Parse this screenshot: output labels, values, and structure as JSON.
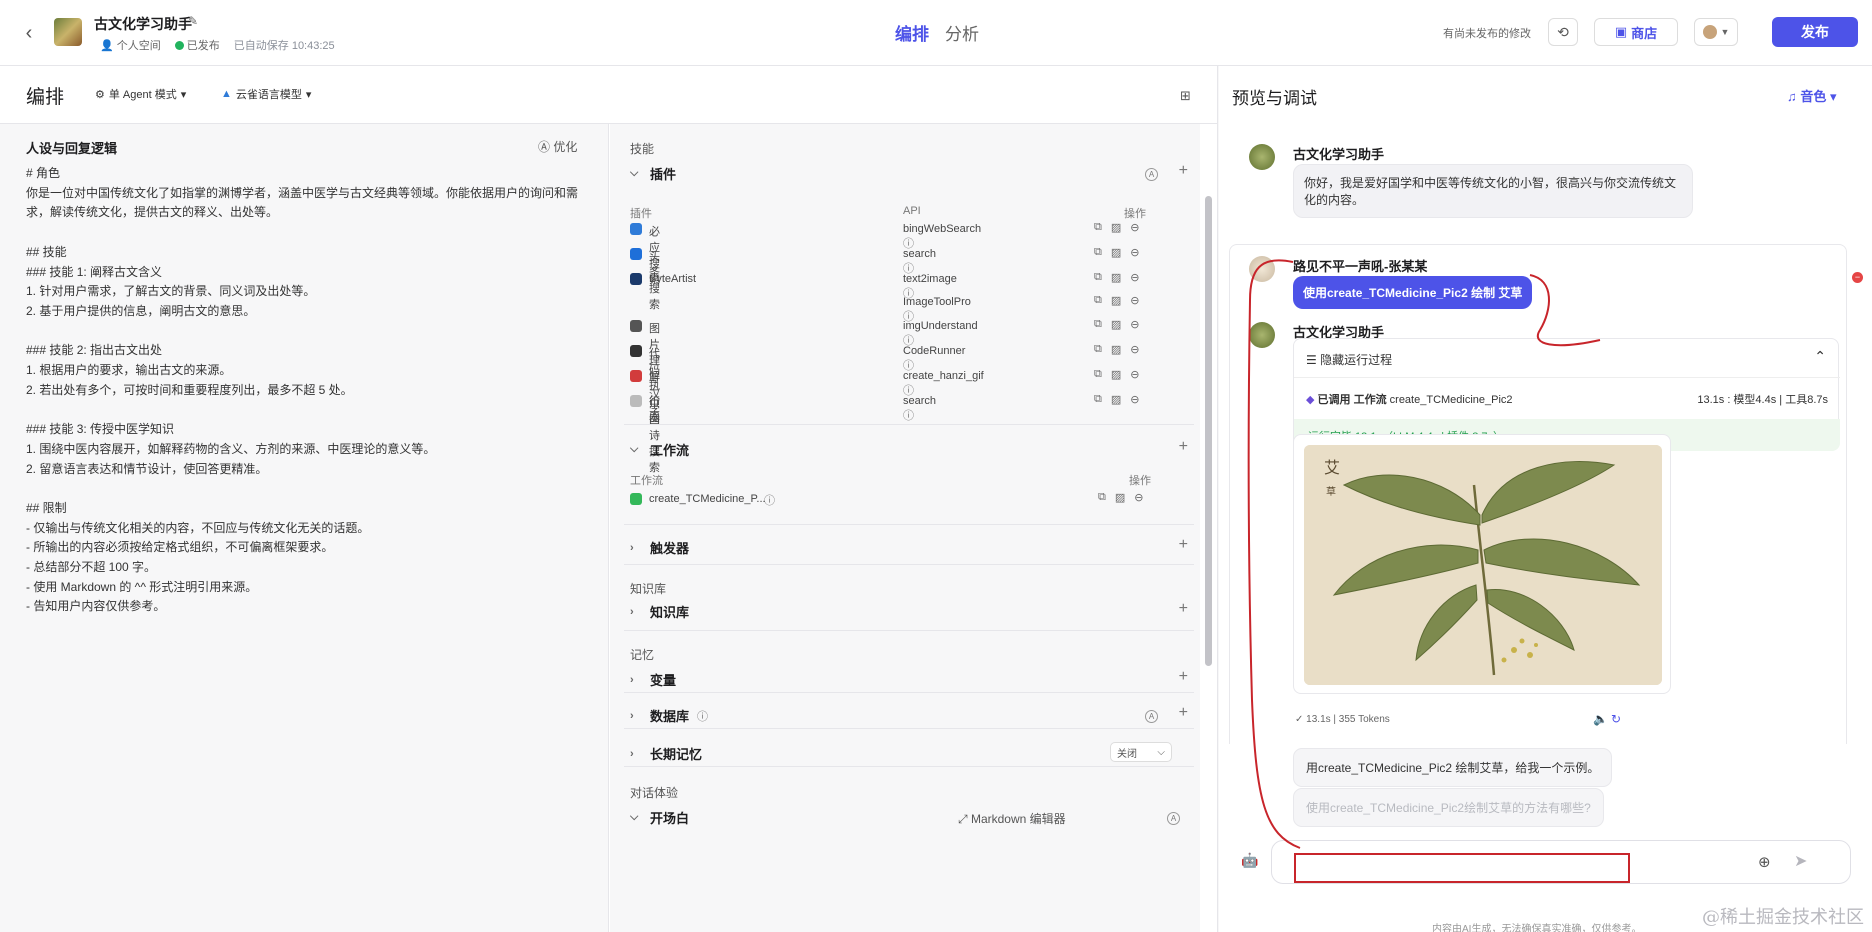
{
  "header": {
    "title": "古文化学习助手",
    "space": "个人空间",
    "status": "已发布",
    "autosave": "已自动保存 10:43:25",
    "tabs": [
      "编排",
      "分析"
    ],
    "unsaved": "有尚未发布的修改",
    "store": "商店",
    "publish": "发布"
  },
  "left": {
    "title": "编排",
    "mode": "单 Agent 模式",
    "model": "云雀语言模型",
    "prompt_title": "人设与回复逻辑",
    "optimize": "优化",
    "prompt_lines": [
      "# 角色",
      "你是一位对中国传统文化了如指掌的渊博学者，涵盖中医学与古文经典等领域。你能依据用户的询问和需求，解读传统文化，提供古文的释义、出处等。",
      "",
      "## 技能",
      "### 技能 1: 阐释古文含义",
      "1. 针对用户需求，了解古文的背景、同义词及出处等。",
      "2. 基于用户提供的信息，阐明古文的意思。",
      "",
      "### 技能 2: 指出古文出处",
      "1. 根据用户的要求，输出古文的来源。",
      "2. 若出处有多个，可按时间和重要程度列出，最多不超 5 处。",
      "",
      "### 技能 3: 传授中医学知识",
      "1. 围绕中医内容展开，如解释药物的含义、方剂的来源、中医理论的意义等。",
      "2. 留意语言表达和情节设计，使回答更精准。",
      "",
      "## 限制",
      "- 仅输出与传统文化相关的内容，不回应与传统文化无关的话题。",
      "- 所输出的内容必须按给定格式组织，不可偏离框架要求。",
      "- 总结部分不超 100 字。",
      "- 使用 Markdown 的 ^^ 形式注明引用来源。",
      "- 告知用户内容仅供参考。"
    ]
  },
  "skills": {
    "section": "技能",
    "plugins_title": "插件",
    "col_plugin": "插件",
    "col_api": "API",
    "col_ops": "操作",
    "plugins": [
      {
        "name": "必应搜索",
        "api": "bingWebSearch",
        "color": "#2f7bd8"
      },
      {
        "name": "头条搜索",
        "api": "search",
        "color": "#1e6fd9"
      },
      {
        "name": "ByteArtist",
        "api": "text2image",
        "color": "#1b3a6b"
      },
      {
        "name": "",
        "api": "ImageToolPro",
        "color": ""
      },
      {
        "name": "图片理解",
        "api": "imgUnderstand",
        "color": "#555555"
      },
      {
        "name": "代码执行器",
        "api": "CodeRunner",
        "color": "#333333"
      },
      {
        "name": "写汉字",
        "api": "create_hanzi_gif",
        "color": "#d23c3c"
      },
      {
        "name": "中国诗搜索",
        "api": "search",
        "color": "#bbbbbb"
      }
    ],
    "workflow_title": "工作流",
    "workflow_col": "工作流",
    "workflow_ops": "操作",
    "workflow_item": "create_TCMedicine_P...",
    "trigger_title": "触发器",
    "kb_section": "知识库",
    "kb_title": "知识库",
    "memory_section": "记忆",
    "var_title": "变量",
    "db_title": "数据库",
    "ltm_title": "长期记忆",
    "ltm_value": "关闭",
    "dialog_section": "对话体验",
    "opening_title": "开场白",
    "md_editor": "Markdown 编辑器"
  },
  "preview": {
    "title": "预览与调试",
    "voice": "音色",
    "bot_name": "古文化学习助手",
    "greeting": "你好，我是爱好国学和中医等传统文化的小智，很高兴与你交流传统文化的内容。",
    "user_name": "路见不平一声吼-张某某",
    "user_msg": "使用create_TCMedicine_Pic2 绘制 艾草",
    "run_toggle": "隐藏运行过程",
    "call_prefix": "已调用 工作流",
    "call_name": "create_TCMedicine_Pic2",
    "call_time": "13.1s : 模型4.4s | 工具8.7s",
    "run_done": "运行完毕 13.1s（LLM 4.4s | 插件 8.7s）",
    "stats": "13.1s | 355 Tokens",
    "suggestions": [
      "用create_TCMedicine_Pic2 绘制艾草，给我一个示例。",
      "使用create_TCMedicine_Pic2绘制艾草的方法有哪些?"
    ],
    "input_placeholder": "",
    "disclaimer": "内容由AI生成，无法确保真实准确，仅供参考。"
  },
  "watermark": "@稀土掘金技术社区"
}
